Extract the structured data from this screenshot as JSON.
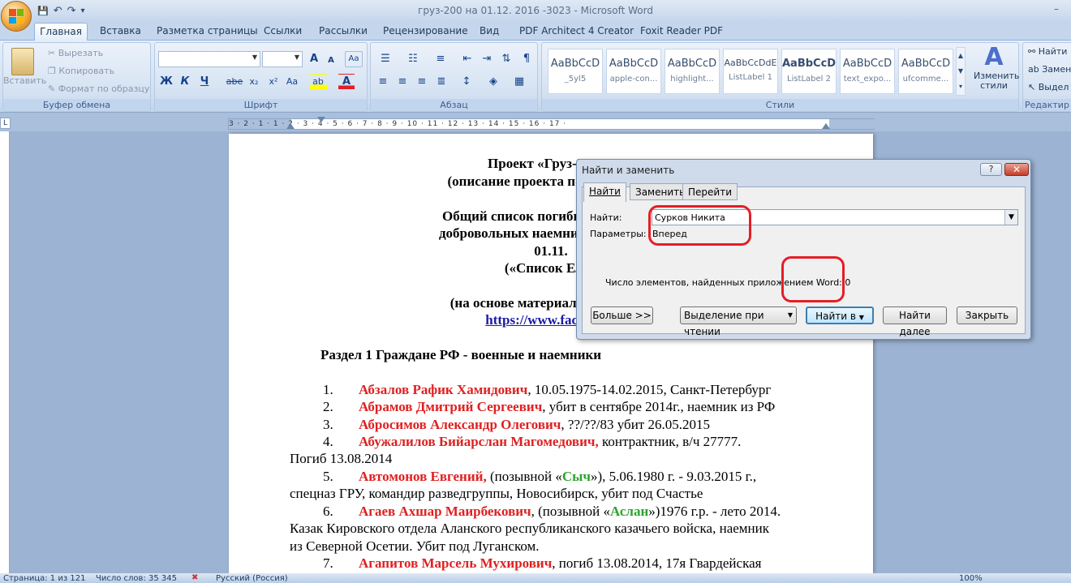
{
  "window": {
    "title": "груз-200 на 01.12. 2016 -3023 - Microsoft Word",
    "minimize_glyph": "–"
  },
  "qat": {
    "save": "💾",
    "undo": "↶",
    "redo": "↷",
    "more": "▾"
  },
  "tabs": [
    "Главная",
    "Вставка",
    "Разметка страницы",
    "Ссылки",
    "Рассылки",
    "Рецензирование",
    "Вид",
    "PDF Architect 4 Creator",
    "Foxit Reader PDF"
  ],
  "ribbon": {
    "clipboard": {
      "paste": "Вставить",
      "cut": "Вырезать",
      "copy": "Копировать",
      "format_painter": "Формат по образцу",
      "label": "Буфер обмена"
    },
    "font": {
      "label": "Шрифт",
      "grow": "A",
      "shrink": "A",
      "clear": "Aa",
      "bold": "Ж",
      "italic": "К",
      "underline": "Ч",
      "strike": "abe",
      "sub": "x₂",
      "sup": "x²",
      "case": "Aa",
      "highlight": "ab",
      "color": "A"
    },
    "paragraph": {
      "label": "Абзац"
    },
    "styles": {
      "label": "Стили",
      "items": [
        {
          "preview": "AaBbCcD",
          "name": "_5yl5"
        },
        {
          "preview": "AaBbCcD",
          "name": "apple-con..."
        },
        {
          "preview": "AaBbCcD",
          "name": "highlight..."
        },
        {
          "preview": "AaBbCcDdE",
          "name": "ListLabel 1"
        },
        {
          "preview": "AaBbCcD",
          "name": "ListLabel 2"
        },
        {
          "preview": "AaBbCcD",
          "name": "text_expo..."
        },
        {
          "preview": "AaBbCcD",
          "name": "ufcomme..."
        }
      ],
      "change": "Изменить стили"
    },
    "editing": {
      "find": "Найти",
      "replace": "Замен",
      "select": "Выдел",
      "label": "Редактир"
    }
  },
  "ruler": {
    "text": "3 · 2 · 1 · 1 · 2 · 3 · 4 · 5 · 6 · 7 · 8 · 9 · 10 · 11 · 12 · 13 · 14 · 15 · 16 · 17 ·"
  },
  "document": {
    "title1": "Проект «Груз-200 из",
    "title2_a": "(описание проекта по адресу ",
    "title2_link": "http",
    "p3": "Общий список погибших на Донба",
    "p4": "добровольных наемников, установл",
    "p5": "01.11.",
    "p6": "(«Список Елен",
    "p7": "(на основе материалов группы «",
    "p8_link": "https://www.facebook.",
    "section": "Раздел 1 Граждане РФ - военные и наемники",
    "entries": [
      {
        "num": "1.",
        "name": "Абзалов Рафик Хамидович",
        "rest": ", 10.05.1975-14.02.2015, Санкт-Петербург"
      },
      {
        "num": "2.",
        "name": "Абрамов Дмитрий Сергеевич",
        "rest": ", убит в сентябре 2014г., наемник из РФ"
      },
      {
        "num": "3.",
        "name": "Абросимов Александр Олегович",
        "rest": ", ??/??/83 убит 26.05.2015"
      },
      {
        "num": "4.",
        "name": "Абужалилов Бийарслан Магомедович,",
        "rest": " контрактник, в/ч 27777.",
        "cont1": "Погиб 13.08.2014"
      },
      {
        "num": "5.",
        "name": "Автомонов Евгений,",
        "rest_a": " (позывной «",
        "callsign": "Сыч",
        "rest_b": "»),  5.06.1980 г. - 9.03.2015 г.,",
        "cont1": "спецназ ГРУ, командир разведгруппы, Новосибирск, убит под Счастье"
      },
      {
        "num": "6.",
        "name": "Агаев Ахшар Маирбекович",
        "rest_a": ", (позывной «",
        "callsign": "Аслан",
        "rest_b": "»)1976 г.р. - лето 2014.",
        "cont1": "Казак Кировского отдела Аланского республиканского казачьего войска, наемник",
        "cont2": "из Северной Осетии. Убит под Луганском."
      },
      {
        "num": "7.",
        "name": "Агапитов Марсель Мухирович",
        "rest": ", погиб 13.08.2014, 17я Гвардейская"
      }
    ]
  },
  "dialog": {
    "title": "Найти и заменить",
    "help": "?",
    "close": "✕",
    "tabs": [
      "Найти",
      "Заменить",
      "Перейти"
    ],
    "find_label": "Найти:",
    "find_value": "Сурков Никита",
    "options_label": "Параметры:",
    "options_value": "Вперед",
    "result": "Число элементов, найденных приложением Word: 0",
    "buttons": {
      "more": "Больше >>",
      "reading_highlight": "Выделение при чтении",
      "find_in": "Найти в",
      "find_next": "Найти далее",
      "close": "Закрыть"
    }
  },
  "statusbar": {
    "page": "Страница: 1 из 121",
    "words": "Число слов: 35 345",
    "lang": "Русский (Россия)",
    "zoom": "100%"
  },
  "colors": {
    "accent": "#e41e26",
    "name_red": "#e02020",
    "callsign_green": "#2aa42a",
    "link": "#1a1aa6"
  }
}
